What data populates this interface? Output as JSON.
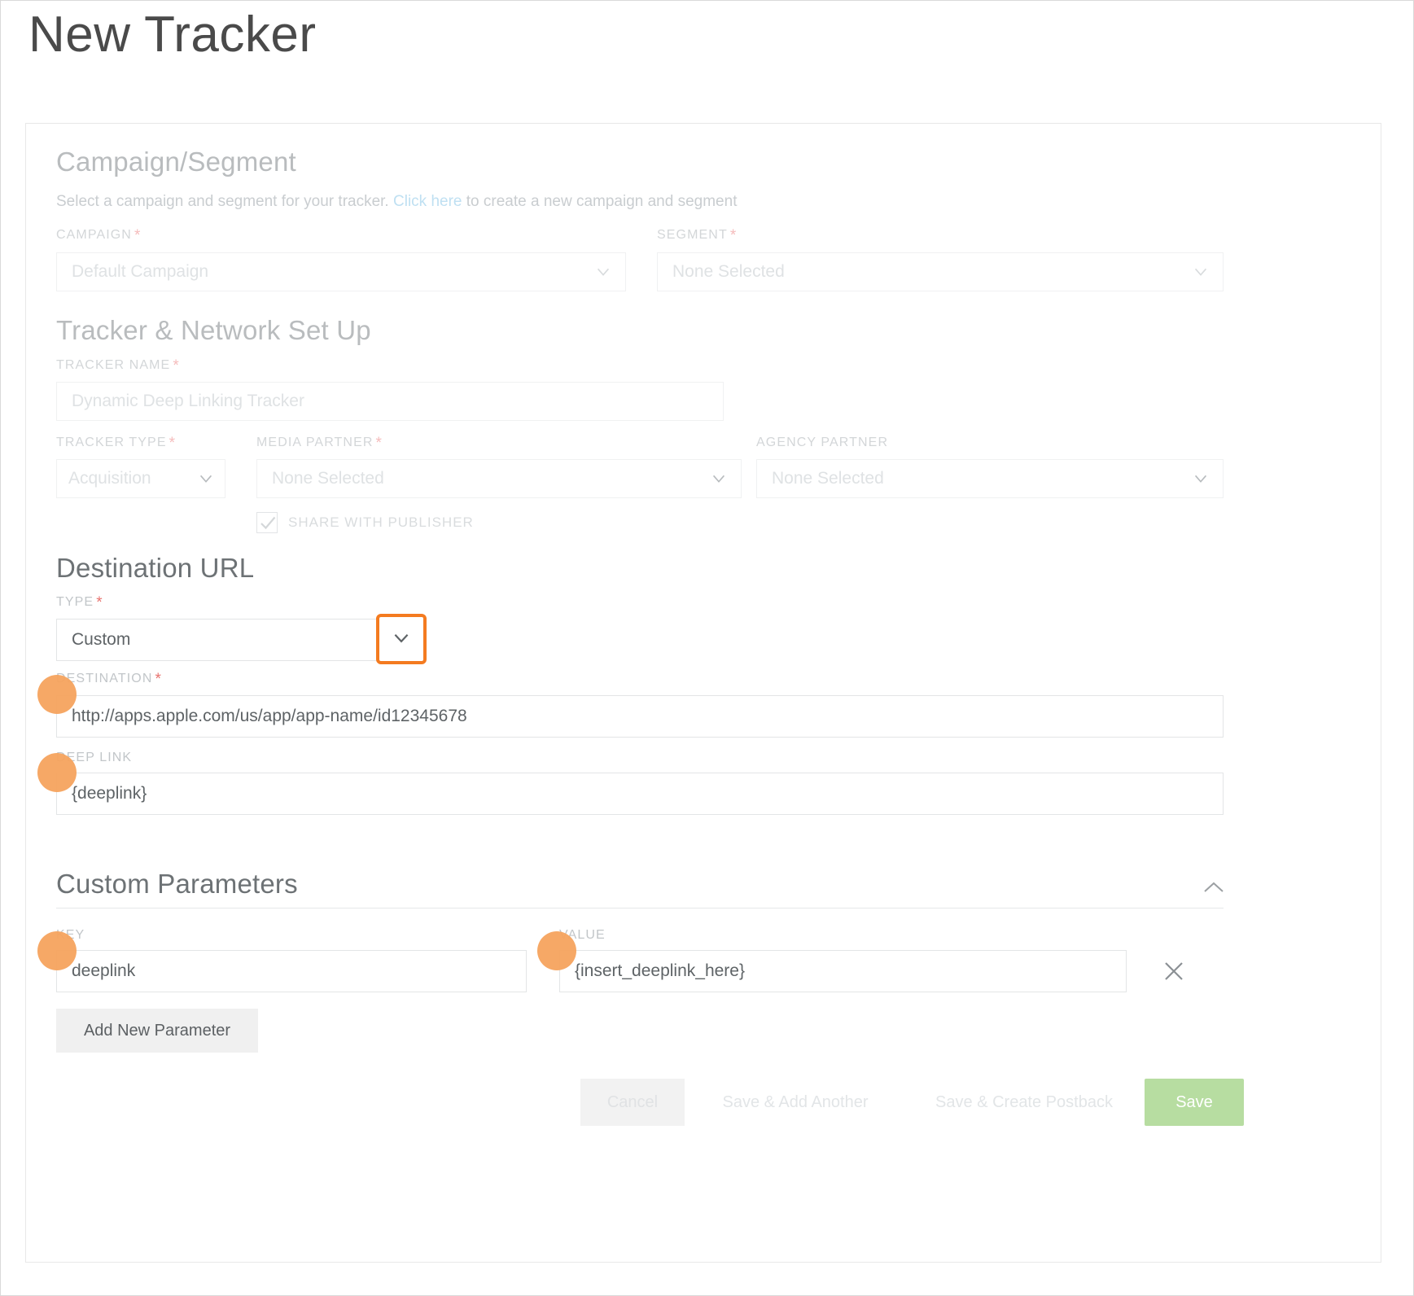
{
  "page": {
    "title": "New Tracker"
  },
  "campaign_section": {
    "heading": "Campaign/Segment",
    "description_before": "Select a campaign and segment for your tracker. ",
    "link_text": "Click here",
    "description_after": " to create a new campaign and segment",
    "campaign_label": "CAMPAIGN",
    "campaign_required": "*",
    "campaign_value": "Default Campaign",
    "segment_label": "SEGMENT",
    "segment_required": "*",
    "segment_value": "None Selected"
  },
  "tracker_section": {
    "heading": "Tracker & Network Set Up",
    "tracker_name_label": "TRACKER NAME",
    "tracker_name_required": "*",
    "tracker_name_value": "Dynamic Deep Linking Tracker",
    "tracker_type_label": "TRACKER TYPE",
    "tracker_type_required": "*",
    "tracker_type_value": "Acquisition",
    "media_partner_label": "MEDIA PARTNER",
    "media_partner_required": "*",
    "media_partner_value": "None Selected",
    "agency_partner_label": "AGENCY PARTNER",
    "agency_partner_value": "None Selected",
    "share_with_publisher_label": "SHARE WITH PUBLISHER",
    "share_with_publisher_checked": true
  },
  "destination_section": {
    "heading": "Destination URL",
    "type_label": "TYPE",
    "type_required": "*",
    "type_value": "Custom",
    "destination_label": "DESTINATION",
    "destination_required": "*",
    "destination_value": "http://apps.apple.com/us/app/app-name/id12345678",
    "deep_link_label": "DEEP LINK",
    "deep_link_value": "{deeplink}"
  },
  "custom_parameters": {
    "heading": "Custom Parameters",
    "key_label": "KEY",
    "value_label": "VALUE",
    "rows": [
      {
        "key": "deeplink",
        "value": "{insert_deeplink_here}"
      }
    ],
    "add_button_label": "Add New Parameter"
  },
  "footer": {
    "cancel_label": "Cancel",
    "save_add_another_label": "Save & Add Another",
    "save_create_postback_label": "Save & Create Postback",
    "save_label": "Save"
  },
  "colors": {
    "highlight": "#f47b20",
    "marker": "#f5a35e",
    "save_button": "#b7dda1",
    "link": "#bfe0f2",
    "required_asterisk": "#f5bcbc"
  }
}
